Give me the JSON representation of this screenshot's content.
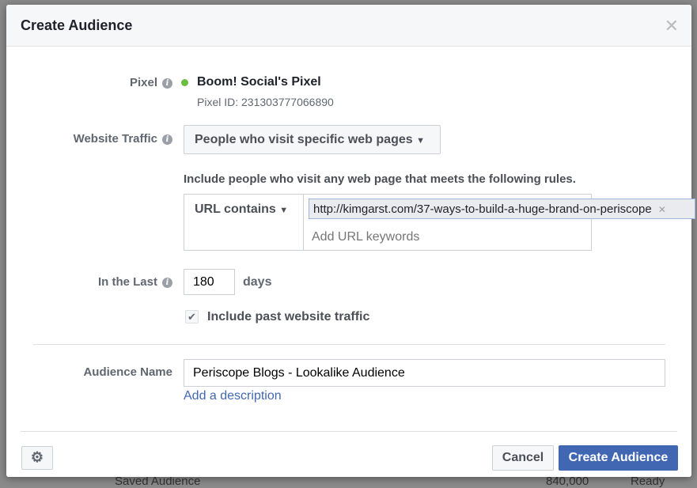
{
  "background": {
    "row_name": "Saved Audience",
    "row_size": "840,000",
    "row_status": "Ready"
  },
  "dialog": {
    "title": "Create Audience",
    "close_icon": "close-icon",
    "pixel": {
      "label": "Pixel",
      "name": "Boom! Social's Pixel",
      "id_text": "Pixel ID: 231303777066890",
      "status_color": "#6bbd3f"
    },
    "website_traffic": {
      "label": "Website Traffic",
      "selected": "People who visit specific web pages"
    },
    "rules": {
      "intro": "Include people who visit any web page that meets the following rules.",
      "condition": "URL contains",
      "url_token": "http://kimgarst.com/37-ways-to-build-a-huge-brand-on-periscope",
      "keyword_placeholder": "Add URL keywords"
    },
    "in_the_last": {
      "label": "In the Last",
      "value": "180",
      "unit": "days"
    },
    "include_past": {
      "label": "Include past website traffic",
      "checked": true
    },
    "audience_name": {
      "label": "Audience Name",
      "value": "Periscope Blogs - Lookalike Audience",
      "add_description": "Add a description"
    },
    "footer": {
      "cancel": "Cancel",
      "create": "Create Audience",
      "primary_color": "#4267b2"
    }
  }
}
